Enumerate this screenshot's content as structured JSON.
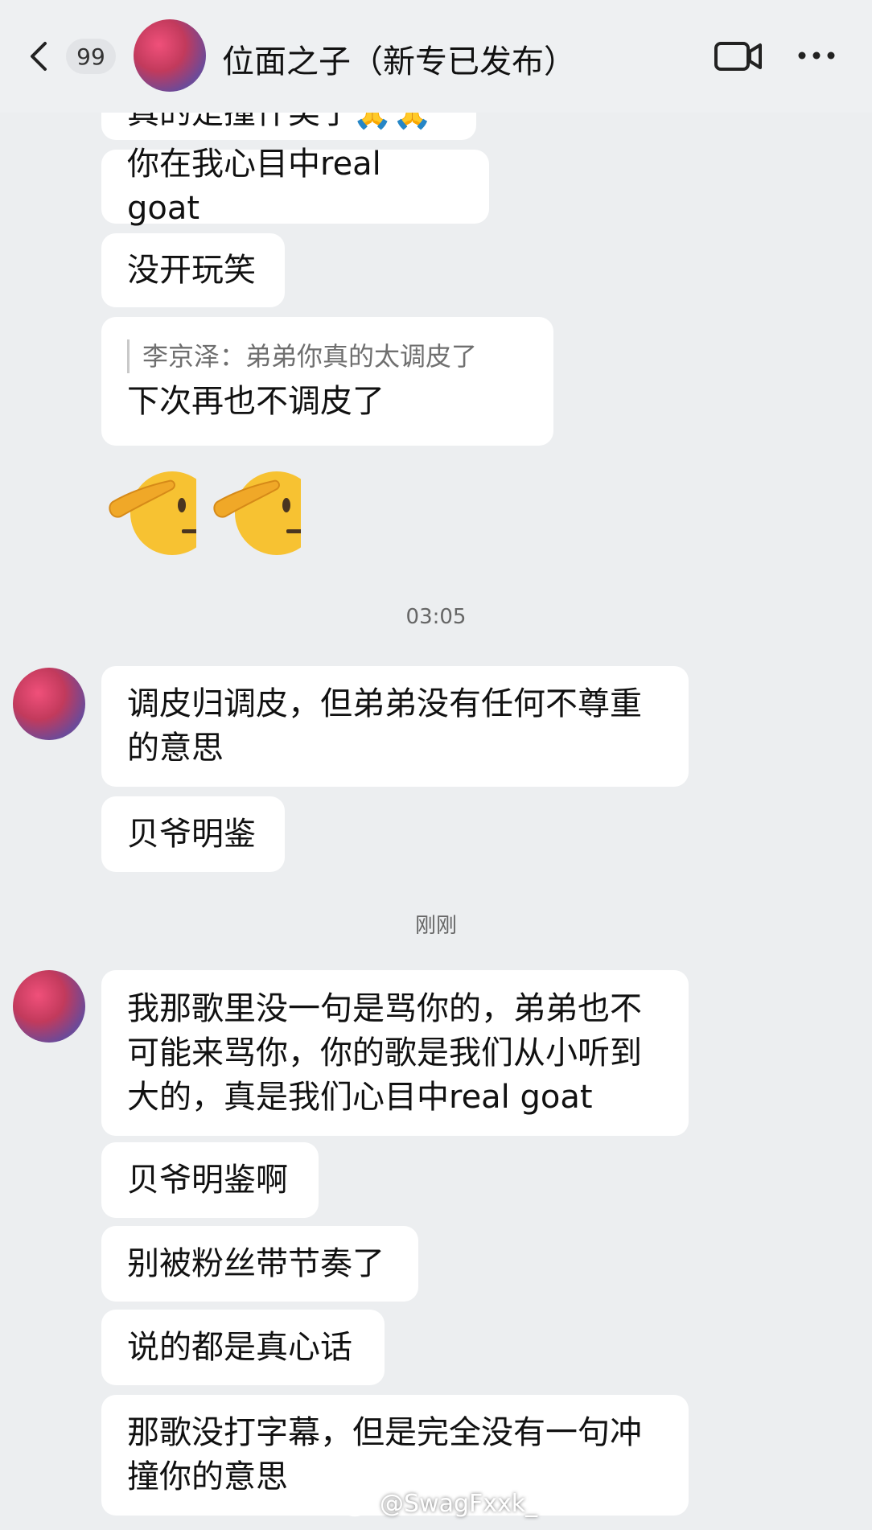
{
  "header": {
    "unread_count": "99",
    "contact_name": "位面之子（新专已发布）",
    "video_call_icon": "video-camera-icon",
    "more_icon": "more-dots-icon"
  },
  "messages": {
    "partial_top": "真的是撞什类了🙏🙏",
    "m1": "你在我心目中real goat",
    "m2": "没开玩笑",
    "m3_quote": "李京泽：弟弟你真的太调皮了",
    "m3": "下次再也不调皮了",
    "time1": "03:05",
    "m4": "调皮归调皮，但弟弟没有任何不尊重的意思",
    "m5": "贝爷明鉴",
    "time2": "刚刚",
    "m6": "我那歌里没一句是骂你的，弟弟也不可能来骂你，你的歌是我们从小听到大的，真是我们心目中real goat",
    "m7": "贝爷明鉴啊",
    "m8": "别被粉丝带节奏了",
    "m9": "说的都是真心话",
    "m10": "那歌没打字幕，但是完全没有一句冲撞你的意思"
  },
  "watermark": {
    "text": "@SwagFxxk_",
    "icon": "weibo-icon"
  },
  "colors": {
    "background": "#eceef0",
    "bubble": "#ffffff",
    "text": "#111111"
  }
}
